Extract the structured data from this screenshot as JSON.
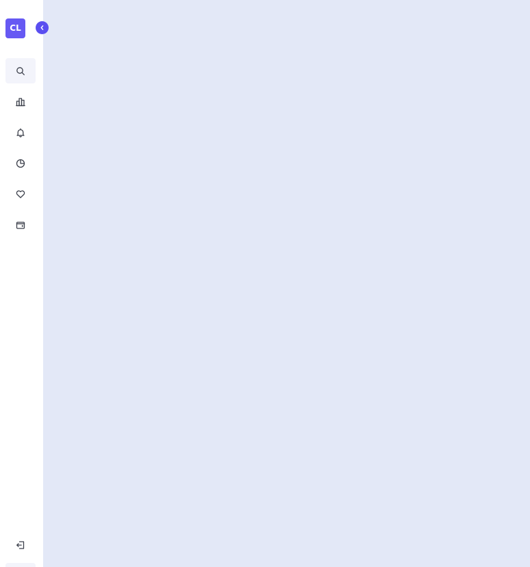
{
  "logo": {
    "text": "CL",
    "color": "#6659f3"
  },
  "collapse_button": {
    "icon": "chevron-left-icon",
    "color": "#5a4ef0"
  },
  "nav": {
    "items": [
      {
        "icon": "search-icon",
        "active": true
      },
      {
        "icon": "bar-chart-icon",
        "active": false
      },
      {
        "icon": "bell-icon",
        "active": false
      },
      {
        "icon": "pie-chart-icon",
        "active": false
      },
      {
        "icon": "heart-icon",
        "active": false
      },
      {
        "icon": "wallet-icon",
        "active": false
      }
    ],
    "logout": {
      "icon": "logout-icon"
    }
  },
  "colors": {
    "main_background": "#e3e8f7",
    "sidebar_background": "#ffffff",
    "active_item_background": "#f3f4fb",
    "icon_stroke": "#3b3f4a"
  }
}
